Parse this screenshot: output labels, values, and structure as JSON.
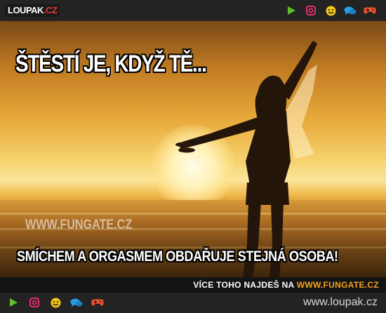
{
  "header": {
    "logo_main": "LOUPAK",
    "logo_tld": ".CZ",
    "icons": [
      "play-icon",
      "instagram-icon",
      "smiley-icon",
      "chat-bubbles-icon",
      "gamepad-icon"
    ]
  },
  "meme": {
    "title": "ŠTĚSTÍ JE, KDYŽ TĚ...",
    "watermark": "WWW.FUNGATE.CZ",
    "caption": "SMÍCHEM A ORGASMEM OBDAŘUJE STEJNÁ OSOBA!"
  },
  "promo": {
    "text": "VÍCE TOHO NAJDEŠ NA",
    "link": "WWW.FUNGATE.CZ"
  },
  "footer": {
    "site": "www.loupak.cz",
    "icons": [
      "play-icon",
      "instagram-icon",
      "smiley-icon",
      "chat-bubbles-icon",
      "gamepad-icon"
    ]
  },
  "colors": {
    "play": "#5fbf2a",
    "instagram": "#e2306c",
    "smiley": "#f5c518",
    "chat": "#2a9de8",
    "gamepad": "#f2552c",
    "accent": "#f7a21b"
  }
}
